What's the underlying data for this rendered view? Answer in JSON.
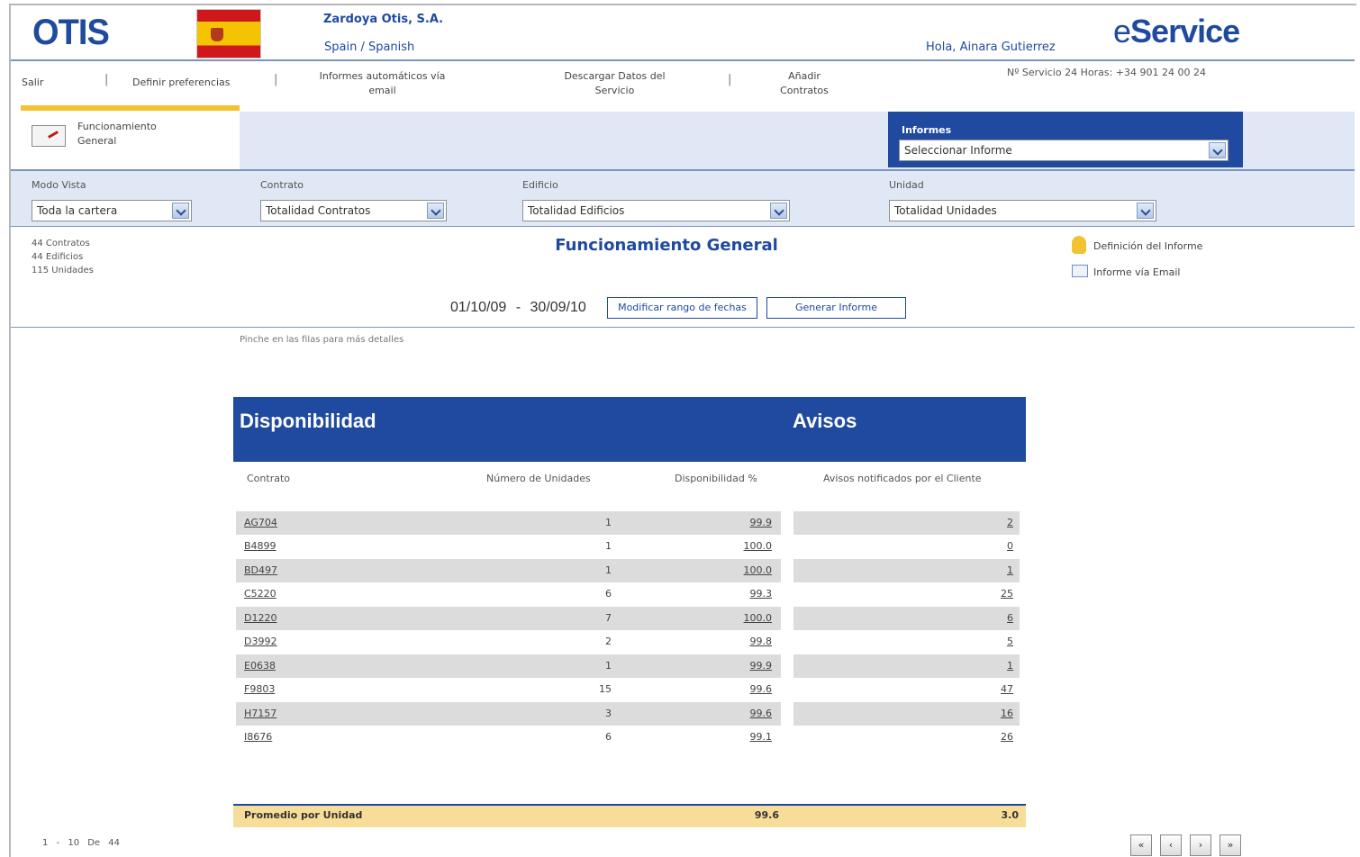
{
  "header": {
    "logo": "OTIS",
    "company": "Zardoya Otis, S.A.",
    "language": "Spain / Spanish",
    "greeting": "Hola, Ainara Gutierrez",
    "brand_e": "e",
    "brand_rest": "Service"
  },
  "nav": {
    "items": [
      {
        "label": "Salir"
      },
      {
        "label": "Definir preferencias"
      },
      {
        "label": "Informes automáticos vía email"
      },
      {
        "label": "Descargar Datos del Servicio"
      },
      {
        "label": "Añadir Contratos"
      }
    ],
    "phone": "Nº Servicio 24 Horas: +34 901 24 00 24"
  },
  "tab": {
    "label": "Funcionamiento General"
  },
  "informes": {
    "label": "Informes",
    "selected": "Seleccionar Informe"
  },
  "filters": {
    "modo_vista": {
      "label": "Modo Vista",
      "value": "Toda la cartera"
    },
    "contrato": {
      "label": "Contrato",
      "value": "Totalidad Contratos"
    },
    "edificio": {
      "label": "Edificio",
      "value": "Totalidad Edificios"
    },
    "unidad": {
      "label": "Unidad",
      "value": "Totalidad Unidades"
    }
  },
  "summary": {
    "contratos": "44 Contratos",
    "edificios": "44 Edificios",
    "unidades": "115 Unidades",
    "title": "Funcionamiento General",
    "definicion": "Definición del Informe",
    "email": "Informe vía Email",
    "date_from": "01/10/09",
    "date_sep": "-",
    "date_to": "30/09/10",
    "modify_button": "Modificar rango de fechas",
    "generate_button": "Generar Informe",
    "hint": "Pinche en las filas para más detalles"
  },
  "table": {
    "section_left": "Disponibilidad",
    "section_right": "Avisos",
    "columns": {
      "contrato": "Contrato",
      "unidades": "Número de Unidades",
      "disponibilidad": "Disponibilidad %",
      "avisos": "Avisos notificados por el Cliente"
    },
    "rows": [
      {
        "contrato": "AG704",
        "unidades": "1",
        "disponibilidad": "99.9",
        "avisos": "2"
      },
      {
        "contrato": "B4899",
        "unidades": "1",
        "disponibilidad": "100.0",
        "avisos": "0"
      },
      {
        "contrato": "BD497",
        "unidades": "1",
        "disponibilidad": "100.0",
        "avisos": "1"
      },
      {
        "contrato": "C5220",
        "unidades": "6",
        "disponibilidad": "99.3",
        "avisos": "25"
      },
      {
        "contrato": "D1220",
        "unidades": "7",
        "disponibilidad": "100.0",
        "avisos": "6"
      },
      {
        "contrato": "D3992",
        "unidades": "2",
        "disponibilidad": "99.8",
        "avisos": "5"
      },
      {
        "contrato": "E0638",
        "unidades": "1",
        "disponibilidad": "99.9",
        "avisos": "1"
      },
      {
        "contrato": "F9803",
        "unidades": "15",
        "disponibilidad": "99.6",
        "avisos": "47"
      },
      {
        "contrato": "H7157",
        "unidades": "3",
        "disponibilidad": "99.6",
        "avisos": "16"
      },
      {
        "contrato": "I8676",
        "unidades": "6",
        "disponibilidad": "99.1",
        "avisos": "26"
      }
    ],
    "footer": {
      "label": "Promedio por Unidad",
      "disponibilidad": "99.6",
      "avisos": "3.0"
    }
  },
  "pager": {
    "text": "1 - 10 De 44",
    "first": "«",
    "prev": "‹",
    "next": "›",
    "last": "»"
  },
  "colors": {
    "brand_blue": "#1f4aa0",
    "highlight_yellow": "#f2c230",
    "panel_blue": "#dfe8f4"
  }
}
